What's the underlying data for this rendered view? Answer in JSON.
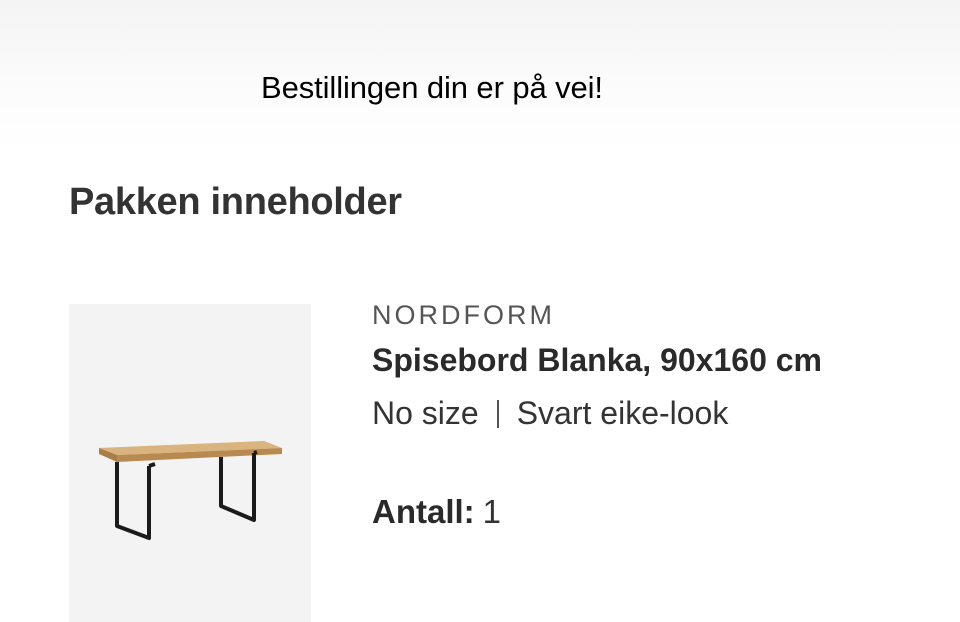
{
  "banner": {
    "message": "Bestillingen din er på vei!"
  },
  "section": {
    "title": "Pakken inneholder"
  },
  "product": {
    "brand": "NORDFORM",
    "name": "Spisebord Blanka, 90x160 cm",
    "size": "No size",
    "separator": "|",
    "color": "Svart eike-look",
    "quantity_label": "Antall:",
    "quantity_value": "1",
    "image_icon": "dining-table-image"
  },
  "colors": {
    "text_dark": "#2a2a2a",
    "brand_grey": "#555555",
    "image_bg": "#f3f3f3",
    "table_top": "#c9a067",
    "table_legs": "#1a1a1a"
  }
}
